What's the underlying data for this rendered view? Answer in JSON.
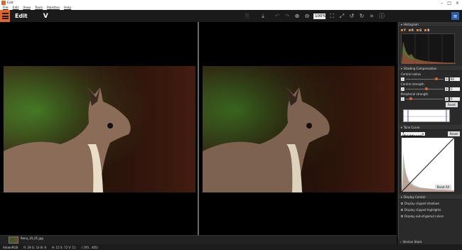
{
  "window": {
    "title": "Edit"
  },
  "menu": [
    "File",
    "Edit",
    "View",
    "Tools",
    "Palettes",
    "Help"
  ],
  "toolbar": {
    "mode_title": "Edit",
    "zoom": "100%"
  },
  "filmstrip": {
    "filename": "Rena_10_01.jpg"
  },
  "panels": {
    "histogram": {
      "title": "Histogram",
      "channels": [
        "Y",
        "R",
        "G",
        "B"
      ]
    },
    "shading": {
      "title": "Shading Compensation",
      "central_radius_label": "Central radius",
      "central_radius_value": "80",
      "central_strength_label": "Central strength",
      "central_strength_value": "0",
      "peripheral_strength_label": "Peripheral strength",
      "peripheral_strength_value": "0",
      "reset": "Reset"
    },
    "tone_curve": {
      "title": "Tone Curve",
      "channel": "Y (Brightness)",
      "reset": "Reset",
      "reset_all": "Reset All"
    },
    "display_control": {
      "title": "Display Control",
      "options": [
        "Display clipped shadows",
        "Display clipped highlights",
        "Display out-of-gamut colors"
      ]
    },
    "version_stack": {
      "title": "Version Stack"
    }
  },
  "status": {
    "colorspace": "AdobeRGB",
    "rgb": "R: 29 G: 14 B: 8",
    "hsv": "H: 15 S: 72 V: 11",
    "coords": "( 195 , 405)"
  }
}
